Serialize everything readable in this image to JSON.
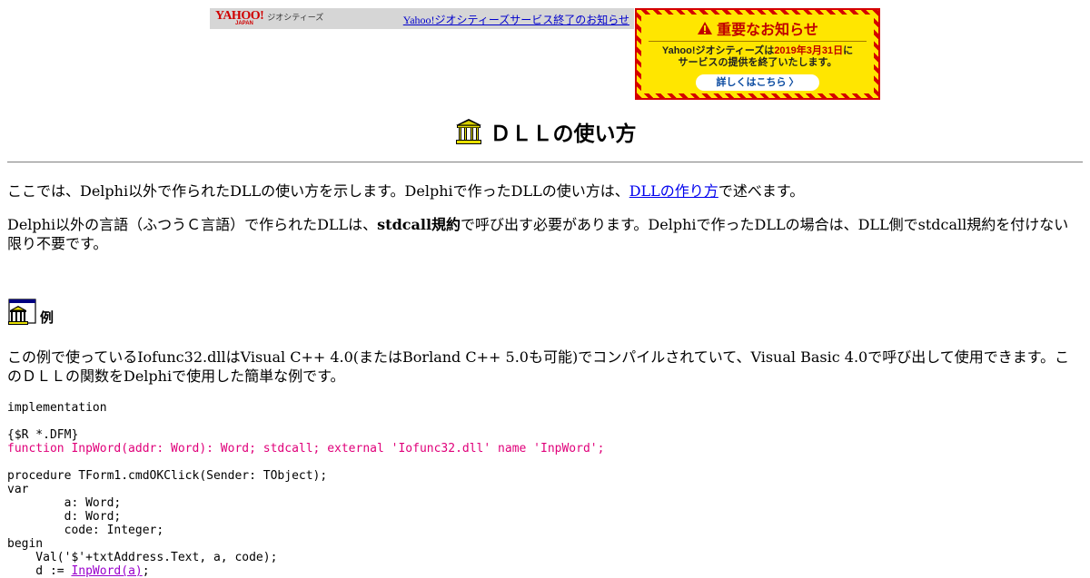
{
  "header": {
    "logo_text": "YAHOO!",
    "logo_sub": "JAPAN",
    "logo_service": "ジオシティーズ",
    "notice_link": "Yahoo!ジオシティーズサービス終了のお知らせ"
  },
  "banner": {
    "title": "重要なお知らせ",
    "msg_line1_pre": "Yahoo!ジオシティーズは",
    "msg_line1_date": "2019年3月31日",
    "msg_line1_post": "に",
    "msg_line2": "サービスの提供を終了いたします。",
    "button": "詳しくはこちら 〉"
  },
  "page": {
    "title": "ＤＬＬの使い方",
    "p1_pre": "ここでは、Delphi以外で作られたDLLの使い方を示します。Delphiで作ったDLLの使い方は、",
    "p1_link": "DLLの作り方",
    "p1_post": "で述べます。",
    "p2_pre": "Delphi以外の言語（ふつうＣ言語）で作られたDLLは、",
    "p2_bold": "stdcall規約",
    "p2_post": "で呼び出す必要があります。Delphiで作ったDLLの場合は、DLL側でstdcall規約を付けない限り不要です。",
    "section_title": "例",
    "p3": "この例で使っているIofunc32.dllはVisual C++ 4.0(またはBorland C++ 5.0も可能)でコンパイルされていて、Visual Basic 4.0で呼び出して使用できます。このＤＬＬの関数をDelphiで使用した簡単な例です。"
  },
  "code": {
    "l1": "implementation",
    "l2": "",
    "l3": "{$R *.DFM}",
    "l4": "function InpWord(addr: Word): Word; stdcall; external 'Iofunc32.dll' name 'InpWord';",
    "l5": "",
    "l6": "procedure TForm1.cmdOKClick(Sender: TObject);",
    "l7": "var",
    "l8": "        a: Word;",
    "l9": "        d: Word;",
    "l10": "        code: Integer;",
    "l11": "begin",
    "l12": "    Val('$'+txtAddress.Text, a, code);",
    "l13_pre": "    d := ",
    "l13_call": "InpWord(a)",
    "l13_post": ";"
  },
  "colors": {
    "banner_red": "#d40000",
    "banner_yellow": "#ffe600",
    "code_highlight": "#e0007a",
    "link_blue": "#0000ee"
  }
}
